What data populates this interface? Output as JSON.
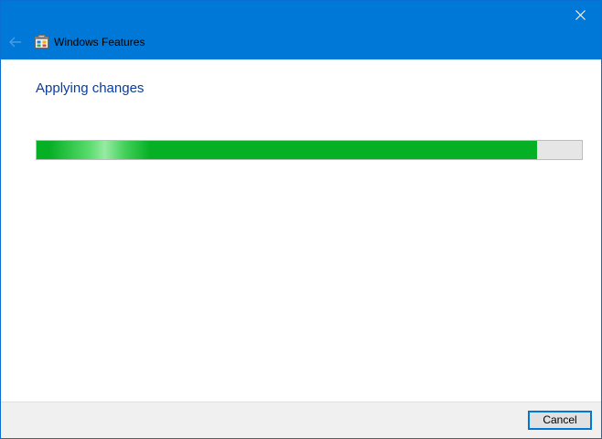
{
  "window": {
    "title": "Windows Features",
    "icons": {
      "back": "back-arrow-icon",
      "app": "windows-features-icon",
      "close": "close-icon"
    }
  },
  "main": {
    "heading": "Applying changes",
    "progress": {
      "fraction": 0.917
    }
  },
  "footer": {
    "cancel_label": "Cancel"
  },
  "colors": {
    "titlebar": "#0078d7",
    "heading": "#0a3c9e",
    "progress_fill": "#06b025",
    "progress_track": "#e6e6e6",
    "footer": "#f0f0f0"
  }
}
